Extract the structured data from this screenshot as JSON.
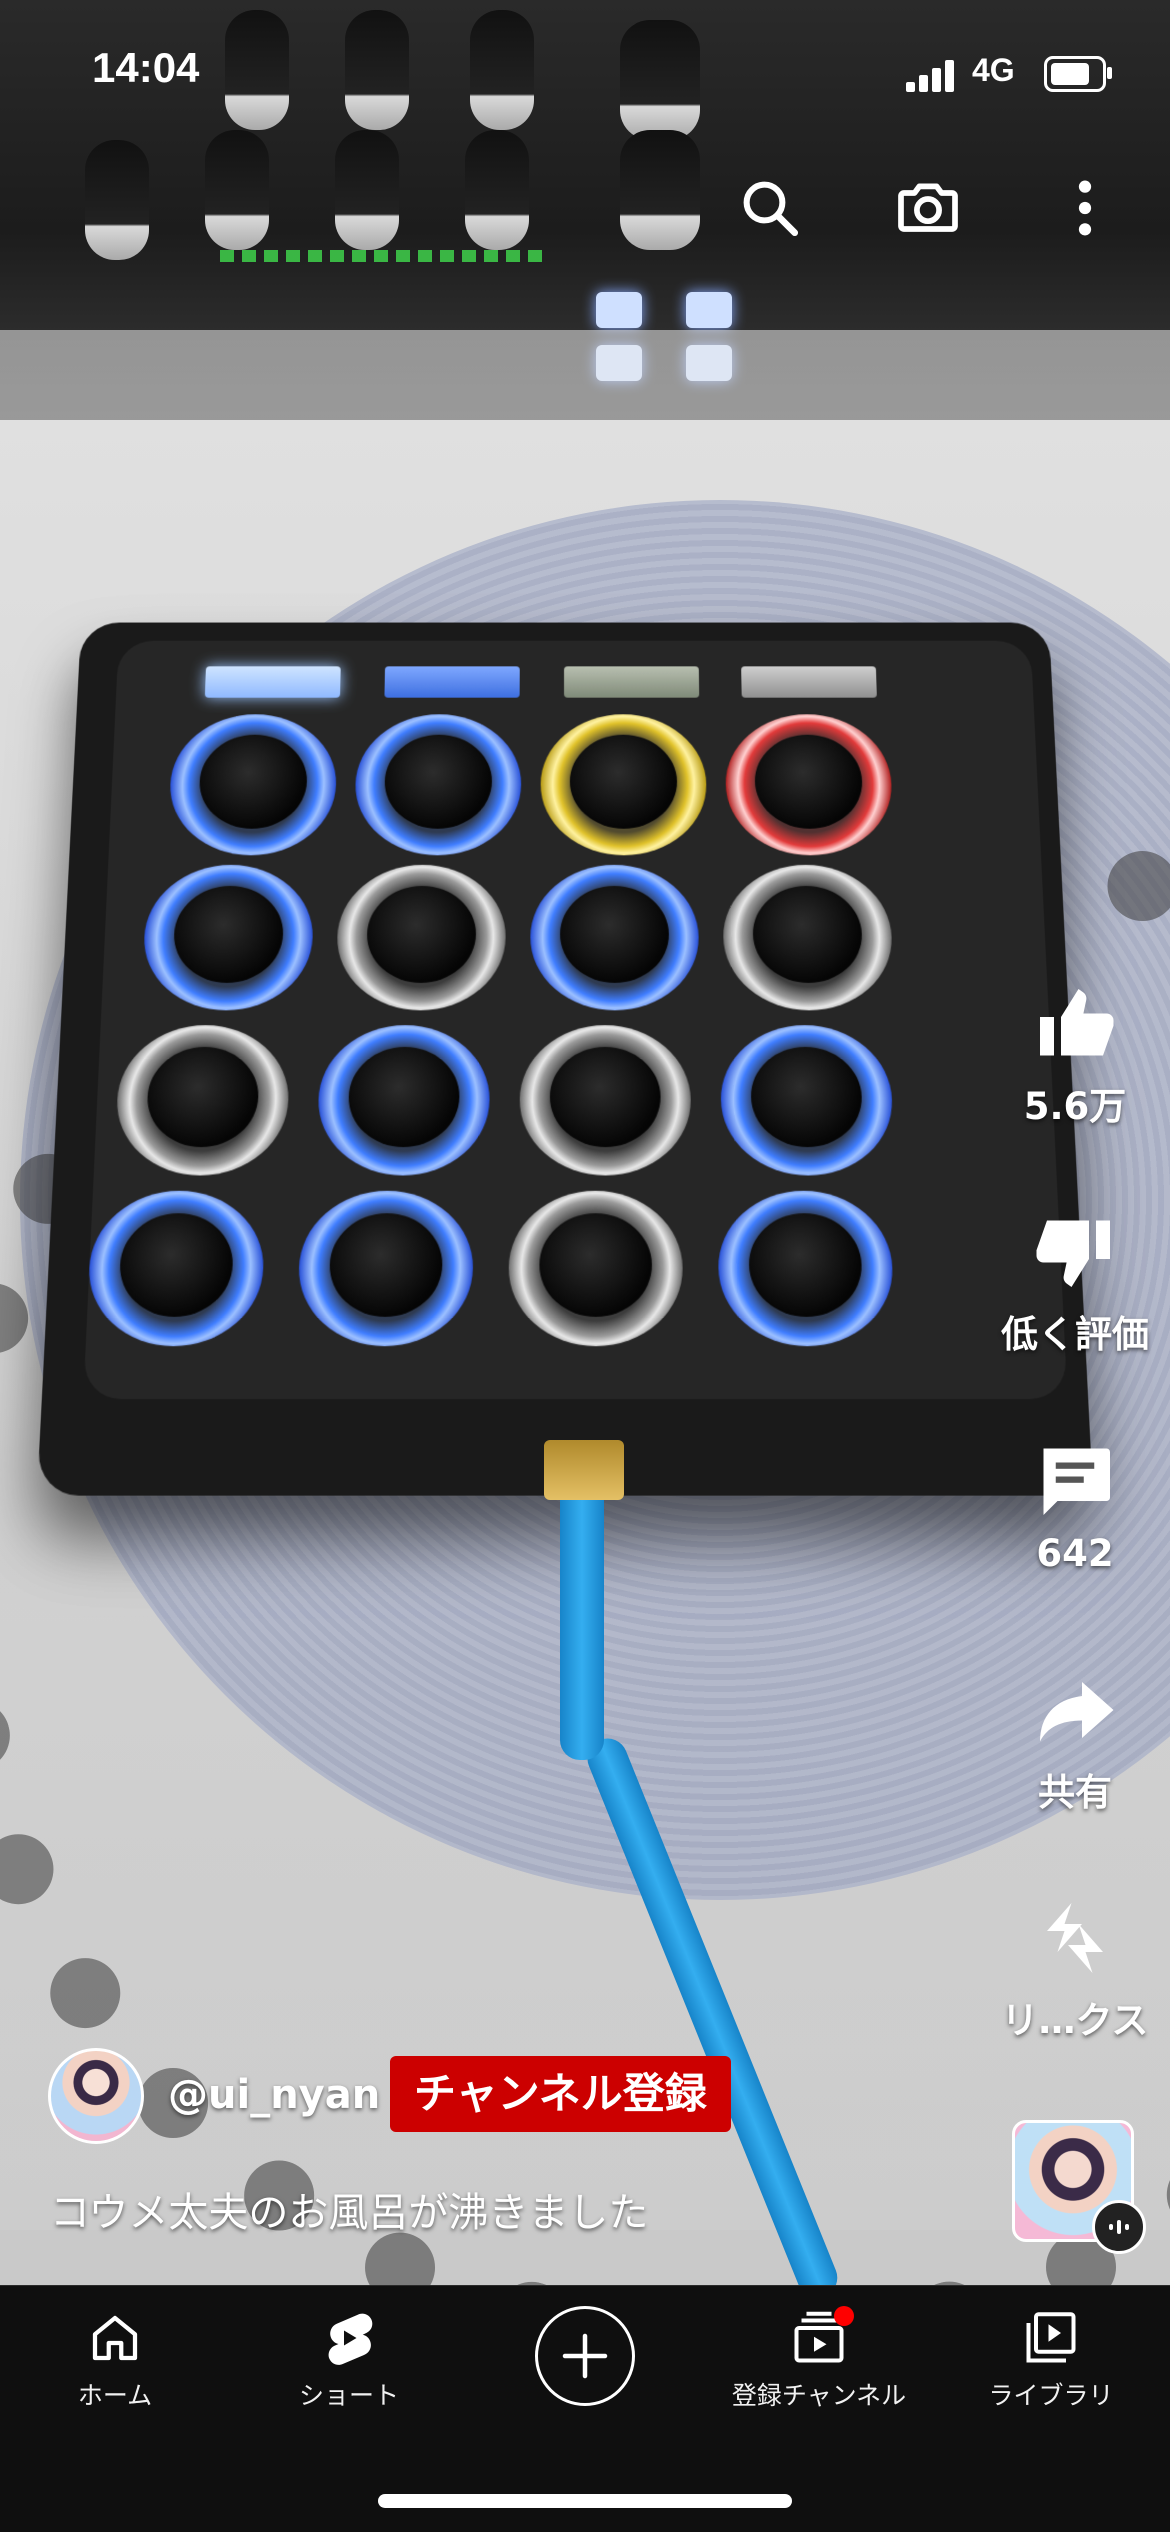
{
  "status_bar": {
    "time": "14:04",
    "network": "4G",
    "battery_level": 0.8
  },
  "top_bar": {
    "icons": [
      "search-icon",
      "camera-icon",
      "more-vert-icon"
    ]
  },
  "actions": {
    "like": {
      "label": "5.6万",
      "icon": "thumb-up-icon"
    },
    "dislike": {
      "label": "低く評価",
      "icon": "thumb-down-icon"
    },
    "comments": {
      "label": "642",
      "icon": "comment-icon"
    },
    "share": {
      "label": "共有",
      "icon": "share-icon"
    },
    "remix": {
      "label": "リ…クス",
      "icon": "remix-icon"
    }
  },
  "channel": {
    "handle": "@ui_nyan",
    "subscribe_label": "チャンネル登録"
  },
  "caption": "コウメ太夫のお風呂が沸きました",
  "nav": {
    "items": [
      {
        "label": "ホーム",
        "icon": "home-icon"
      },
      {
        "label": "ショート",
        "icon": "shorts-icon"
      },
      {
        "label": "",
        "icon": "create-plus-icon"
      },
      {
        "label": "登録チャンネル",
        "icon": "subscriptions-icon"
      },
      {
        "label": "ライブラリ",
        "icon": "library-icon"
      }
    ]
  },
  "colors": {
    "subscribe_bg": "#cc0000",
    "nav_bg": "#0f0f0f",
    "notification": "#ff0000",
    "cable": "#2aa3ea"
  }
}
